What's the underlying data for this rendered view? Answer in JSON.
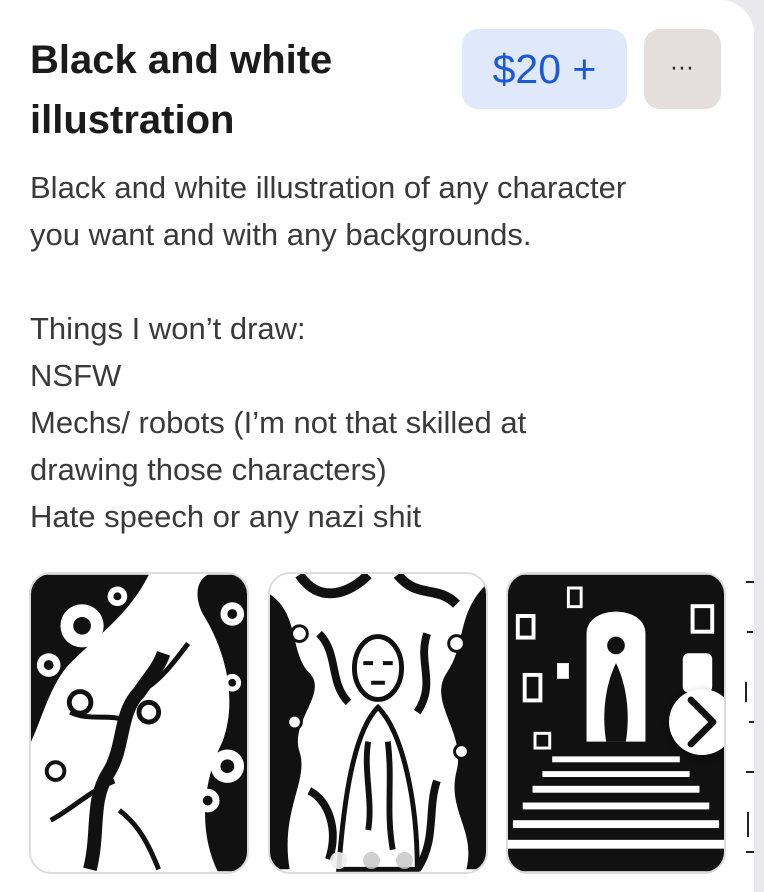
{
  "card": {
    "title": "Black and white illustration",
    "price": "$20 +",
    "more_label": "···",
    "description_lines": [
      "Black and white illustration of any character",
      "you want and with any backgrounds.",
      "",
      "Things I won’t draw:",
      "NSFW",
      "Mechs/ robots (I’m not that skilled at",
      "drawing those characters)",
      "Hate speech or any nazi shit"
    ]
  },
  "gallery": {
    "images": [
      {
        "icon": "ink-illustration-eyes-tree"
      },
      {
        "icon": "ink-illustration-figure-swirls"
      },
      {
        "icon": "ink-illustration-doorway-stairs"
      }
    ],
    "next_icon": "chevron-right-icon",
    "pagination_count": 3,
    "active_page": 0
  },
  "colors": {
    "price_bg": "#dfe9fb",
    "price_text": "#1d58d8",
    "more_bg": "#e4dedc"
  }
}
